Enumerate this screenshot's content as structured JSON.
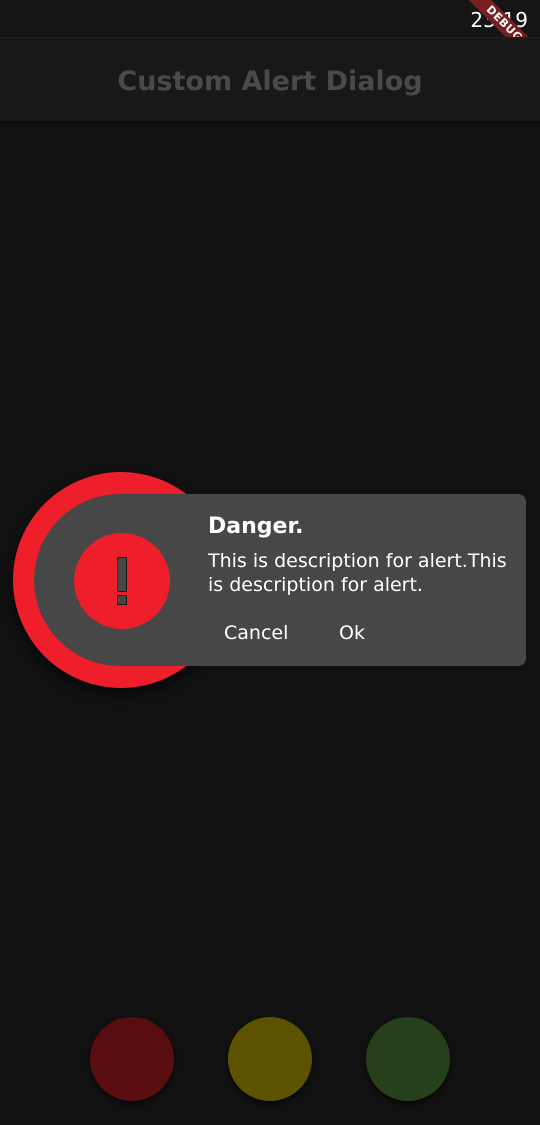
{
  "status_bar": {
    "time": "23:19",
    "debug_label": "DEBUG"
  },
  "app_bar": {
    "title": "Custom Alert Dialog"
  },
  "dialog": {
    "icon": "exclamation-icon",
    "title": "Danger.",
    "description": "This is description for alert.This is description for alert.",
    "cancel_label": "Cancel",
    "ok_label": "Ok",
    "accent_color": "#ee1f2b",
    "card_color": "#474747"
  },
  "bottom_buttons": [
    {
      "name": "red",
      "color": "#5a0d10"
    },
    {
      "name": "yellow",
      "color": "#5c5200"
    },
    {
      "name": "green",
      "color": "#25401a"
    }
  ]
}
